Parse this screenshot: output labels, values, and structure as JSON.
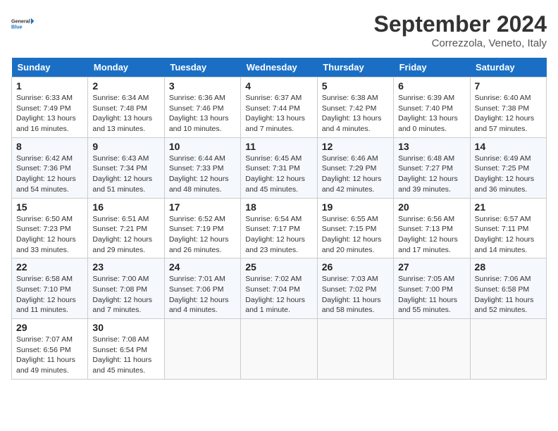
{
  "header": {
    "logo_general": "General",
    "logo_blue": "Blue",
    "month_title": "September 2024",
    "location": "Correzzola, Veneto, Italy"
  },
  "weekdays": [
    "Sunday",
    "Monday",
    "Tuesday",
    "Wednesday",
    "Thursday",
    "Friday",
    "Saturday"
  ],
  "weeks": [
    [
      {
        "day": 1,
        "sunrise": "Sunrise: 6:33 AM",
        "sunset": "Sunset: 7:49 PM",
        "daylight": "Daylight: 13 hours and 16 minutes."
      },
      {
        "day": 2,
        "sunrise": "Sunrise: 6:34 AM",
        "sunset": "Sunset: 7:48 PM",
        "daylight": "Daylight: 13 hours and 13 minutes."
      },
      {
        "day": 3,
        "sunrise": "Sunrise: 6:36 AM",
        "sunset": "Sunset: 7:46 PM",
        "daylight": "Daylight: 13 hours and 10 minutes."
      },
      {
        "day": 4,
        "sunrise": "Sunrise: 6:37 AM",
        "sunset": "Sunset: 7:44 PM",
        "daylight": "Daylight: 13 hours and 7 minutes."
      },
      {
        "day": 5,
        "sunrise": "Sunrise: 6:38 AM",
        "sunset": "Sunset: 7:42 PM",
        "daylight": "Daylight: 13 hours and 4 minutes."
      },
      {
        "day": 6,
        "sunrise": "Sunrise: 6:39 AM",
        "sunset": "Sunset: 7:40 PM",
        "daylight": "Daylight: 13 hours and 0 minutes."
      },
      {
        "day": 7,
        "sunrise": "Sunrise: 6:40 AM",
        "sunset": "Sunset: 7:38 PM",
        "daylight": "Daylight: 12 hours and 57 minutes."
      }
    ],
    [
      {
        "day": 8,
        "sunrise": "Sunrise: 6:42 AM",
        "sunset": "Sunset: 7:36 PM",
        "daylight": "Daylight: 12 hours and 54 minutes."
      },
      {
        "day": 9,
        "sunrise": "Sunrise: 6:43 AM",
        "sunset": "Sunset: 7:34 PM",
        "daylight": "Daylight: 12 hours and 51 minutes."
      },
      {
        "day": 10,
        "sunrise": "Sunrise: 6:44 AM",
        "sunset": "Sunset: 7:33 PM",
        "daylight": "Daylight: 12 hours and 48 minutes."
      },
      {
        "day": 11,
        "sunrise": "Sunrise: 6:45 AM",
        "sunset": "Sunset: 7:31 PM",
        "daylight": "Daylight: 12 hours and 45 minutes."
      },
      {
        "day": 12,
        "sunrise": "Sunrise: 6:46 AM",
        "sunset": "Sunset: 7:29 PM",
        "daylight": "Daylight: 12 hours and 42 minutes."
      },
      {
        "day": 13,
        "sunrise": "Sunrise: 6:48 AM",
        "sunset": "Sunset: 7:27 PM",
        "daylight": "Daylight: 12 hours and 39 minutes."
      },
      {
        "day": 14,
        "sunrise": "Sunrise: 6:49 AM",
        "sunset": "Sunset: 7:25 PM",
        "daylight": "Daylight: 12 hours and 36 minutes."
      }
    ],
    [
      {
        "day": 15,
        "sunrise": "Sunrise: 6:50 AM",
        "sunset": "Sunset: 7:23 PM",
        "daylight": "Daylight: 12 hours and 33 minutes."
      },
      {
        "day": 16,
        "sunrise": "Sunrise: 6:51 AM",
        "sunset": "Sunset: 7:21 PM",
        "daylight": "Daylight: 12 hours and 29 minutes."
      },
      {
        "day": 17,
        "sunrise": "Sunrise: 6:52 AM",
        "sunset": "Sunset: 7:19 PM",
        "daylight": "Daylight: 12 hours and 26 minutes."
      },
      {
        "day": 18,
        "sunrise": "Sunrise: 6:54 AM",
        "sunset": "Sunset: 7:17 PM",
        "daylight": "Daylight: 12 hours and 23 minutes."
      },
      {
        "day": 19,
        "sunrise": "Sunrise: 6:55 AM",
        "sunset": "Sunset: 7:15 PM",
        "daylight": "Daylight: 12 hours and 20 minutes."
      },
      {
        "day": 20,
        "sunrise": "Sunrise: 6:56 AM",
        "sunset": "Sunset: 7:13 PM",
        "daylight": "Daylight: 12 hours and 17 minutes."
      },
      {
        "day": 21,
        "sunrise": "Sunrise: 6:57 AM",
        "sunset": "Sunset: 7:11 PM",
        "daylight": "Daylight: 12 hours and 14 minutes."
      }
    ],
    [
      {
        "day": 22,
        "sunrise": "Sunrise: 6:58 AM",
        "sunset": "Sunset: 7:10 PM",
        "daylight": "Daylight: 12 hours and 11 minutes."
      },
      {
        "day": 23,
        "sunrise": "Sunrise: 7:00 AM",
        "sunset": "Sunset: 7:08 PM",
        "daylight": "Daylight: 12 hours and 7 minutes."
      },
      {
        "day": 24,
        "sunrise": "Sunrise: 7:01 AM",
        "sunset": "Sunset: 7:06 PM",
        "daylight": "Daylight: 12 hours and 4 minutes."
      },
      {
        "day": 25,
        "sunrise": "Sunrise: 7:02 AM",
        "sunset": "Sunset: 7:04 PM",
        "daylight": "Daylight: 12 hours and 1 minute."
      },
      {
        "day": 26,
        "sunrise": "Sunrise: 7:03 AM",
        "sunset": "Sunset: 7:02 PM",
        "daylight": "Daylight: 11 hours and 58 minutes."
      },
      {
        "day": 27,
        "sunrise": "Sunrise: 7:05 AM",
        "sunset": "Sunset: 7:00 PM",
        "daylight": "Daylight: 11 hours and 55 minutes."
      },
      {
        "day": 28,
        "sunrise": "Sunrise: 7:06 AM",
        "sunset": "Sunset: 6:58 PM",
        "daylight": "Daylight: 11 hours and 52 minutes."
      }
    ],
    [
      {
        "day": 29,
        "sunrise": "Sunrise: 7:07 AM",
        "sunset": "Sunset: 6:56 PM",
        "daylight": "Daylight: 11 hours and 49 minutes."
      },
      {
        "day": 30,
        "sunrise": "Sunrise: 7:08 AM",
        "sunset": "Sunset: 6:54 PM",
        "daylight": "Daylight: 11 hours and 45 minutes."
      },
      null,
      null,
      null,
      null,
      null
    ]
  ]
}
